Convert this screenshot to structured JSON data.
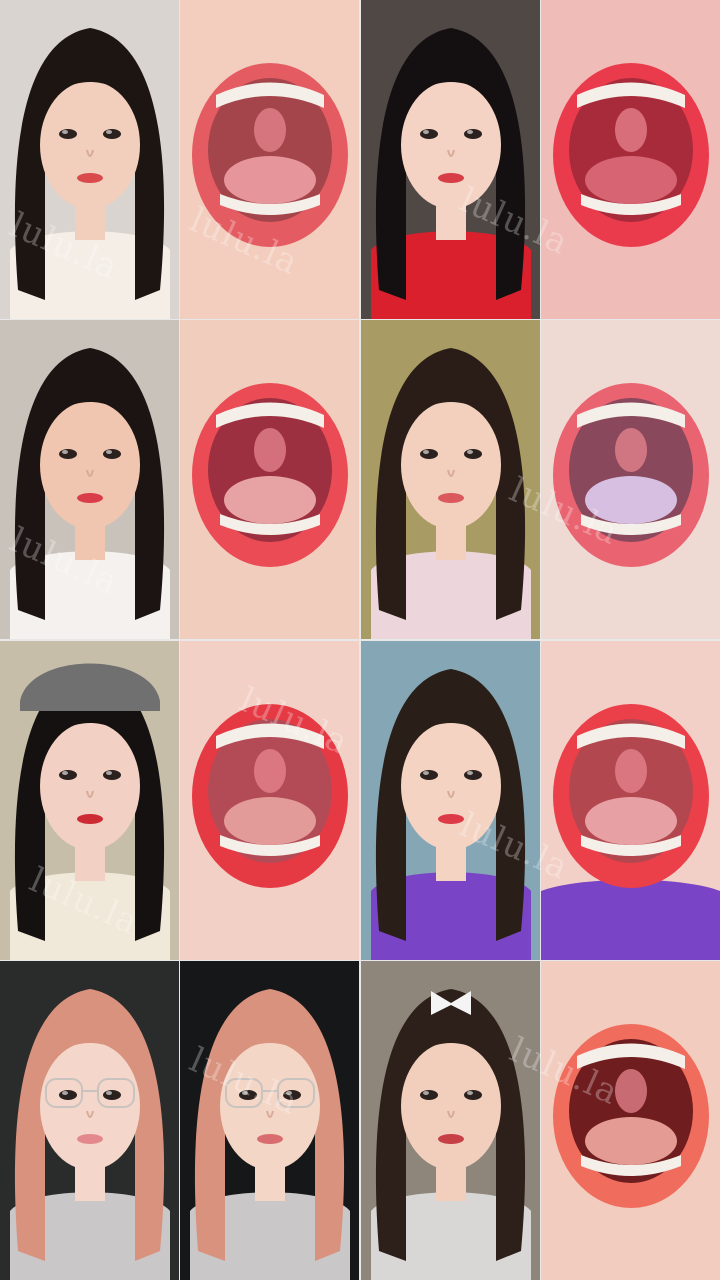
{
  "collage": {
    "watermark_text": "lulu.la",
    "tiles": [
      {
        "kind": "selfie",
        "hair": "#1c1512",
        "skin": "#f2cfbd",
        "shirt": "#f4eee6",
        "bg": "#d9d4cf",
        "lips": "#d94a4c"
      },
      {
        "kind": "mouth",
        "skin": "#f3cdbd",
        "lips": "#e45c62",
        "inner": "#a3454b",
        "tongue": "#e6959a"
      },
      {
        "kind": "selfie",
        "hair": "#141012",
        "skin": "#f4d3c4",
        "shirt": "#d9202c",
        "bg": "#504845",
        "lips": "#d63d46"
      },
      {
        "kind": "mouth",
        "skin": "#f0bcb8",
        "lips": "#ea3b4d",
        "inner": "#a82b3b",
        "tongue": "#d66473"
      },
      {
        "kind": "selfie",
        "hair": "#1b1412",
        "skin": "#f1c6b0",
        "shirt": "#f4f1ee",
        "bg": "#c9c2ba",
        "lips": "#d93d47"
      },
      {
        "kind": "mouth",
        "skin": "#f1cdbe",
        "lips": "#ea4b55",
        "inner": "#9d3040",
        "tongue": "#e7a3a3"
      },
      {
        "kind": "selfie",
        "hair": "#2a1d17",
        "skin": "#f2d0bd",
        "shirt": "#ecd6db",
        "bg": "#a89b63",
        "lips": "#d9595c"
      },
      {
        "kind": "mouth",
        "skin": "#efd9d3",
        "lips": "#ea6370",
        "inner": "#8a485c",
        "tongue": "#d6bfe0"
      },
      {
        "kind": "selfie",
        "hair": "#151111",
        "skin": "#f2d0c3",
        "shirt": "#f0e8d8",
        "bg": "#c7bea9",
        "lips": "#cc2a35",
        "hat": "#707070"
      },
      {
        "kind": "mouth",
        "skin": "#f3d0c6",
        "lips": "#e53a44",
        "inner": "#b34b56",
        "tongue": "#e29b98"
      },
      {
        "kind": "selfie",
        "hair": "#2a1e18",
        "skin": "#f4d3c2",
        "shirt": "#7a44c6",
        "bg": "#84a6b5",
        "lips": "#dc3a46"
      },
      {
        "kind": "mouth",
        "skin": "#f3d0c7",
        "lips": "#eb3f4a",
        "inner": "#b3474f",
        "tongue": "#e7a0a3",
        "shirt": "#7a44c6"
      },
      {
        "kind": "selfie",
        "hair": "#d9927d",
        "skin": "#f4d7ca",
        "shirt": "#c9c7c7",
        "bg": "#2a2b2b",
        "lips": "#e3898c",
        "glasses": true
      },
      {
        "kind": "selfie",
        "hair": "#d9927d",
        "skin": "#f4d6c6",
        "shirt": "#c9c7c7",
        "bg": "#161718",
        "lips": "#d96c6e",
        "glasses": true
      },
      {
        "kind": "selfie",
        "hair": "#2d1f19",
        "skin": "#f2cfbd",
        "shirt": "#d9d7d5",
        "bg": "#8e857b",
        "lips": "#c64046",
        "bow": true
      },
      {
        "kind": "mouth",
        "skin": "#f2cdbf",
        "lips": "#f06d5e",
        "inner": "#6f1d1f",
        "tongue": "#e39b93"
      }
    ]
  }
}
